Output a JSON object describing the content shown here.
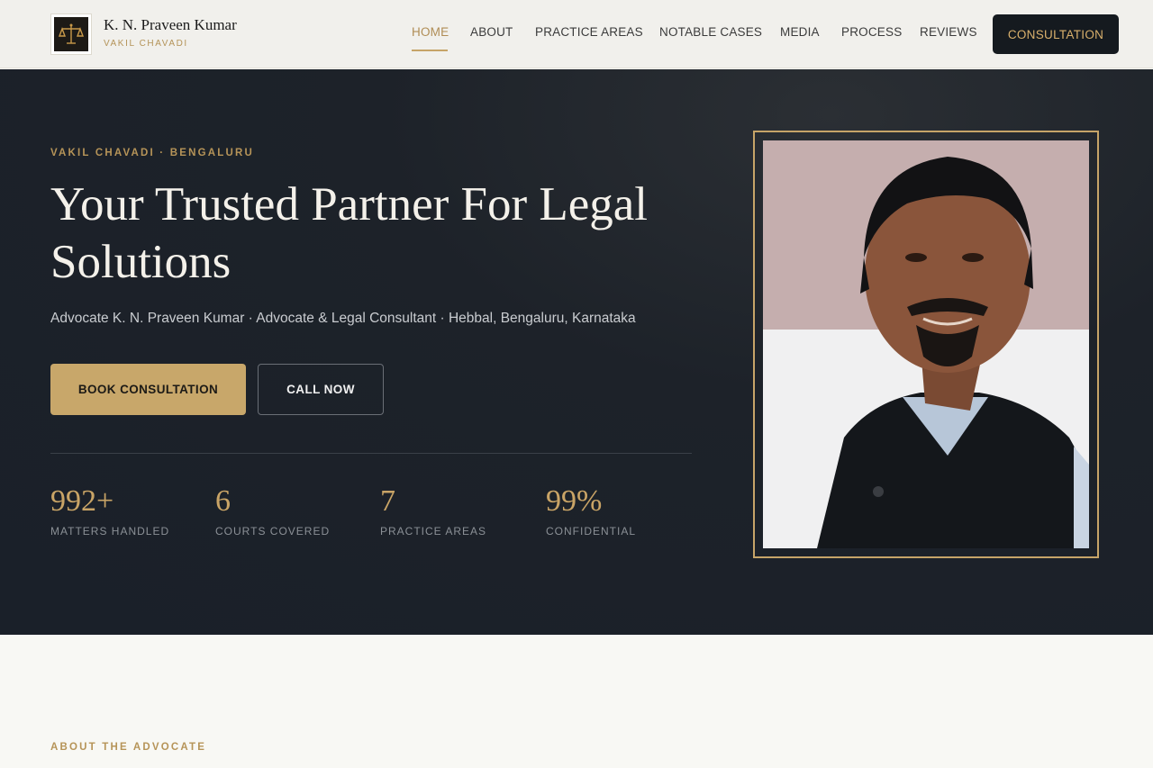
{
  "header": {
    "brand_name": "K. N. Praveen Kumar",
    "brand_sub": "VAKIL CHAVADI",
    "nav": [
      {
        "label": "HOME",
        "active": true
      },
      {
        "label": "ABOUT"
      },
      {
        "label": "PRACTICE AREAS"
      },
      {
        "label": "NOTABLE CASES"
      },
      {
        "label": "MEDIA"
      },
      {
        "label": "PROCESS"
      },
      {
        "label": "REVIEWS"
      }
    ],
    "cta_label": "CONSULTATION"
  },
  "hero": {
    "eyebrow": "VAKIL CHAVADI · BENGALURU",
    "title": "Your Trusted Partner For Legal Solutions",
    "subtitle": "Advocate K. N. Praveen Kumar · Advocate & Legal Consultant · Hebbal, Bengaluru, Karnataka",
    "primary_button": "BOOK CONSULTATION",
    "secondary_button": "CALL NOW",
    "stats": [
      {
        "value": "992+",
        "label": "MATTERS HANDLED"
      },
      {
        "value": "6",
        "label": "COURTS COVERED"
      },
      {
        "value": "7",
        "label": "PRACTICE AREAS"
      },
      {
        "value": "99%",
        "label": "CONFIDENTIAL"
      }
    ]
  },
  "about": {
    "eyebrow": "ABOUT THE ADVOCATE"
  },
  "colors": {
    "accent_gold": "#c8a76a",
    "dark_bg": "#1a2029",
    "header_bg": "#f1f0ec"
  },
  "icons": {
    "logo": "scales-of-justice-icon"
  }
}
